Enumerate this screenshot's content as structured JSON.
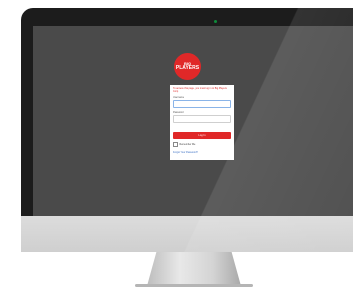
{
  "logo": {
    "line1": "BIG",
    "line2": "PLAYERS",
    "brand_color": "#e02828"
  },
  "login": {
    "notice": "To access this page, you must log in to Big Players Corp",
    "username_label": "Username",
    "password_label": "Password",
    "button_label": "Log In",
    "remember_label": "Remember Me",
    "forgot_label": "Forgot Your Password?"
  }
}
